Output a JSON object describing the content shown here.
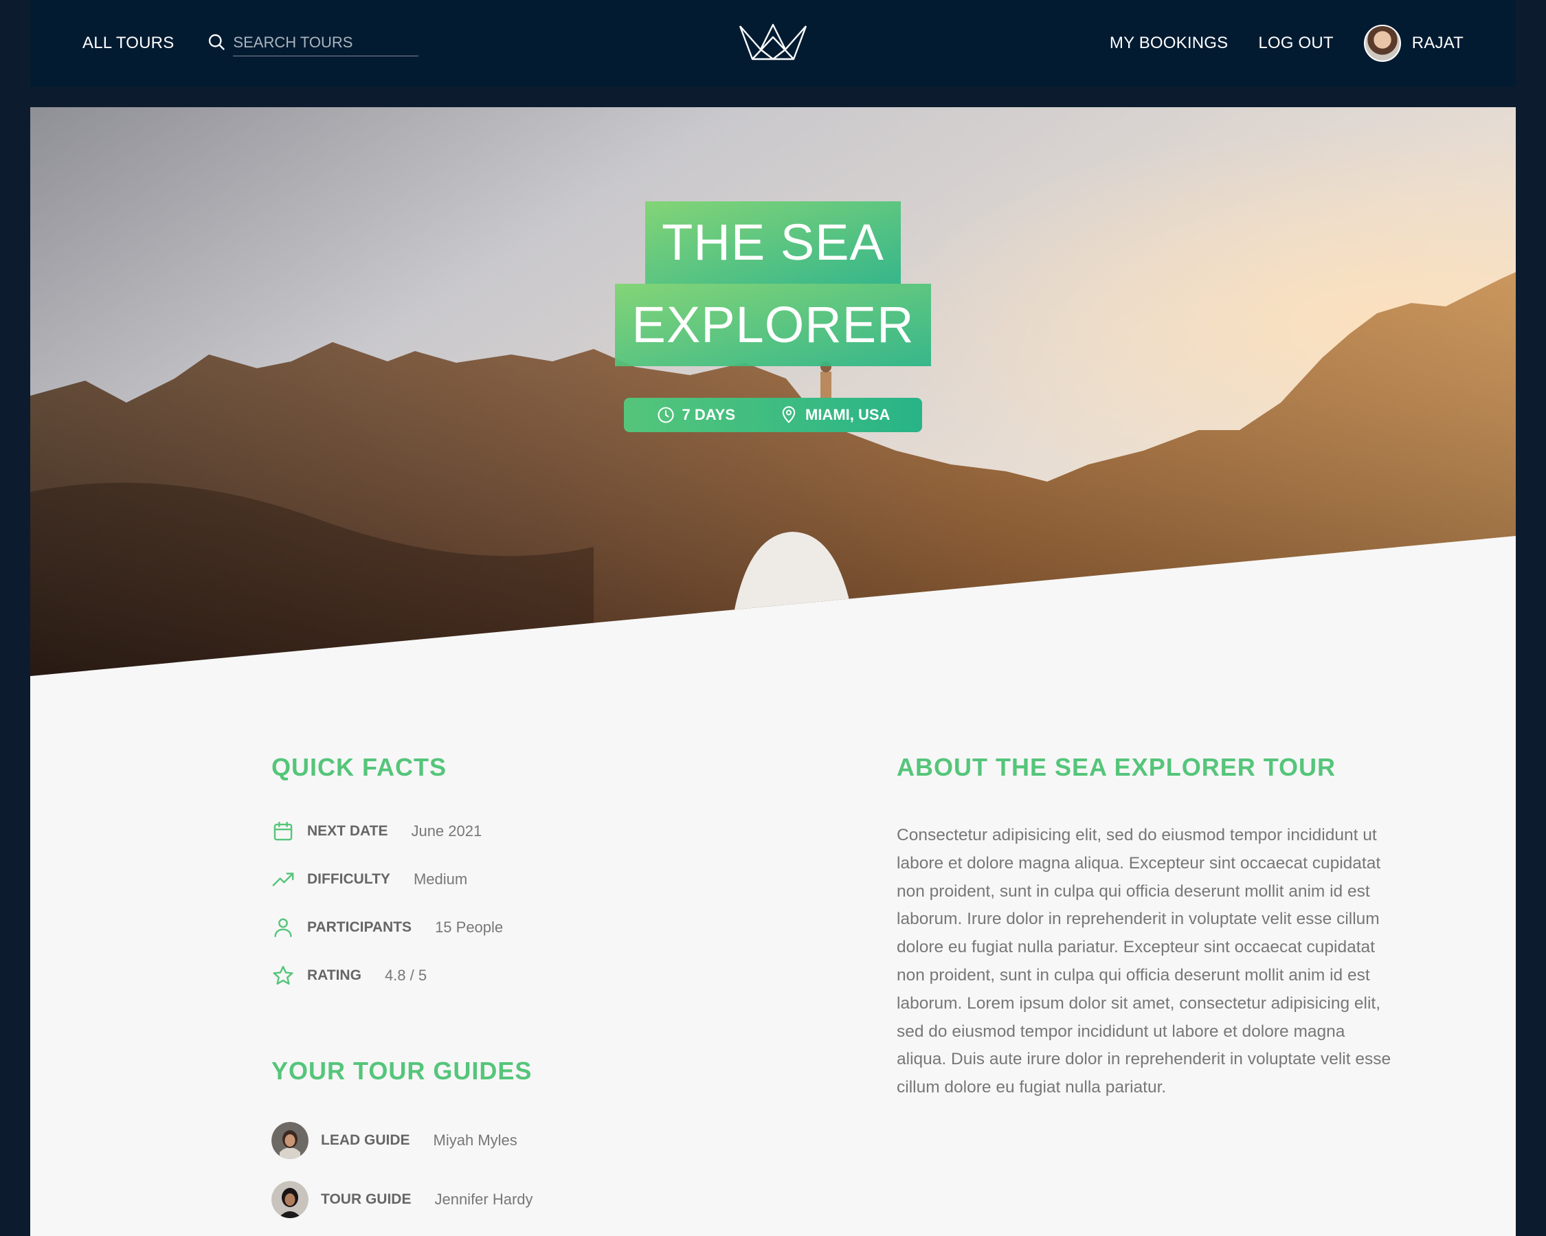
{
  "header": {
    "all_tours": "All tours",
    "search_placeholder": "Search tours",
    "my_bookings": "My bookings",
    "log_out": "Log out",
    "user_name": "Rajat"
  },
  "hero": {
    "title_line1": "The Sea",
    "title_line2": "Explorer",
    "duration": "7 days",
    "location": "Miami, USA"
  },
  "quick_facts": {
    "heading": "Quick facts",
    "items": [
      {
        "icon": "calendar-icon",
        "label": "Next date",
        "value": "June 2021"
      },
      {
        "icon": "trending-up-icon",
        "label": "Difficulty",
        "value": "Medium"
      },
      {
        "icon": "user-icon",
        "label": "Participants",
        "value": "15 People"
      },
      {
        "icon": "star-icon",
        "label": "Rating",
        "value": "4.8 / 5"
      }
    ]
  },
  "guides": {
    "heading": "Your tour guides",
    "items": [
      {
        "label": "Lead guide",
        "name": "Miyah Myles"
      },
      {
        "label": "Tour guide",
        "name": "Jennifer Hardy"
      }
    ]
  },
  "about": {
    "heading": "About the sea explorer tour",
    "text": "Consectetur adipisicing elit, sed do eiusmod tempor incididunt ut labore et dolore magna aliqua. Excepteur sint occaecat cupidatat non proident, sunt in culpa qui officia deserunt mollit anim id est laborum. Irure dolor in reprehenderit in voluptate velit esse cillum dolore eu fugiat nulla pariatur. Excepteur sint occaecat cupidatat non proident, sunt in culpa qui officia deserunt mollit anim id est laborum. Lorem ipsum dolor sit amet, consectetur adipisicing elit, sed do eiusmod tempor incididunt ut labore et dolore magna aliqua. Duis aute irure dolor in reprehenderit in voluptate velit esse cillum dolore eu fugiat nulla pariatur."
  },
  "colors": {
    "accent": "#55c57a",
    "accent_dark": "#28b487",
    "header_bg": "#031b31"
  }
}
